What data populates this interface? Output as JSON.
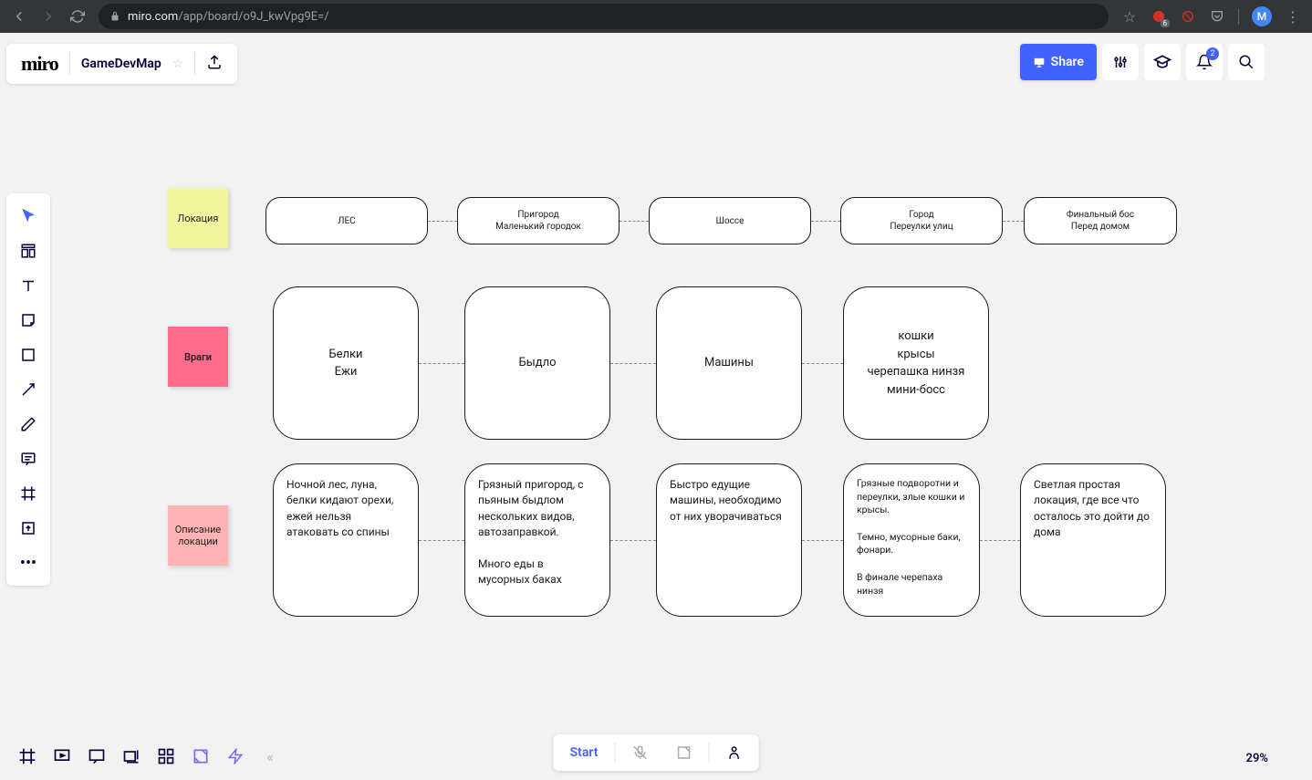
{
  "browser": {
    "url_prefix": "miro.com",
    "url_path": "/app/board/o9J_kwVpg9E=/",
    "ext_count": "6",
    "avatar_letter": "M"
  },
  "header": {
    "logo": "miro",
    "board_name": "GameDevMap",
    "share_label": "Share",
    "notif_count": "2"
  },
  "stickies": {
    "location": "Локация",
    "enemies": "Враги",
    "desc": "Описание локации"
  },
  "locations": [
    "ЛЕС",
    "Пригород\nМаленький городок",
    "Шоссе",
    "Город\nПереулки улиц",
    "Финальный бос\nПеред домом"
  ],
  "enemies": [
    "Белки\nЕжи",
    "Быдло",
    "Машины",
    "кошки\nкрысы\nчерепашка нинзя\nмини-босс"
  ],
  "descriptions": [
    "Ночной лес, луна, белки кидают орехи, ежей нельзя атаковать со спины",
    "Грязный пригород, с пьяным быдлом нескольких видов, автозаправкой.\n\nМного еды в мусорных баках",
    "Быстро едущие машины, необходимо от них уворачиваться",
    "Грязные подворотни и переулки, злые кошки и крысы.\n\nТемно, мусорные баки, фонари.\n\nВ финале черепаха нинзя",
    "Светлая простая локация, где все что осталось это дойти до дома"
  ],
  "bottom": {
    "start": "Start",
    "zoom": "29%"
  }
}
